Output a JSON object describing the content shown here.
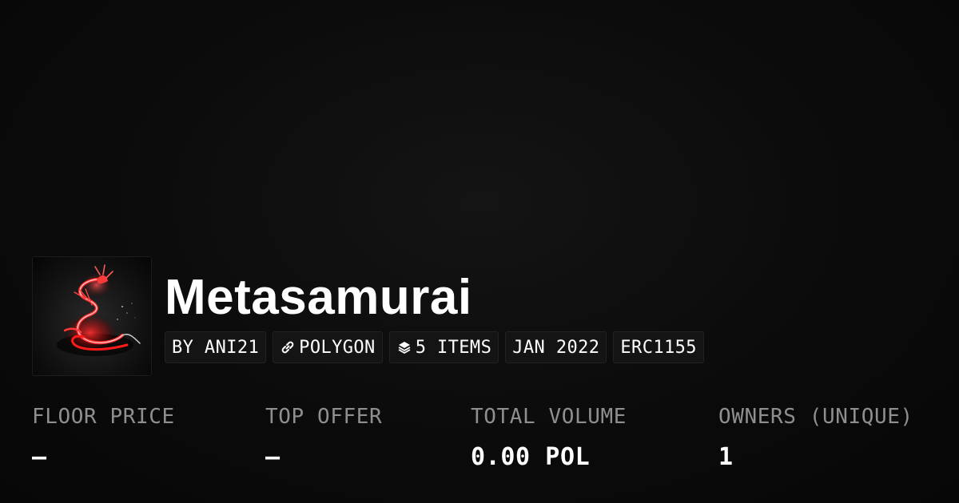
{
  "collection": {
    "name": "Metasamurai",
    "avatar_icon": "red-dragon-logo"
  },
  "badges": {
    "creator": "BY ANI21",
    "chain": "POLYGON",
    "chain_icon": "link-icon",
    "items": "5 ITEMS",
    "items_icon": "layers-icon",
    "date": "JAN 2022",
    "standard": "ERC1155"
  },
  "stats": {
    "floor_price": {
      "label": "FLOOR PRICE",
      "value": "–"
    },
    "top_offer": {
      "label": "TOP OFFER",
      "value": "–"
    },
    "total_volume": {
      "label": "TOTAL VOLUME",
      "value": "0.00 POL"
    },
    "owners": {
      "label": "OWNERS (UNIQUE)",
      "value": "1"
    }
  },
  "colors": {
    "background": "#0b0b0b",
    "badge_bg": "#141414",
    "label_gray": "#8f8f8f",
    "accent_red": "#e01818"
  }
}
